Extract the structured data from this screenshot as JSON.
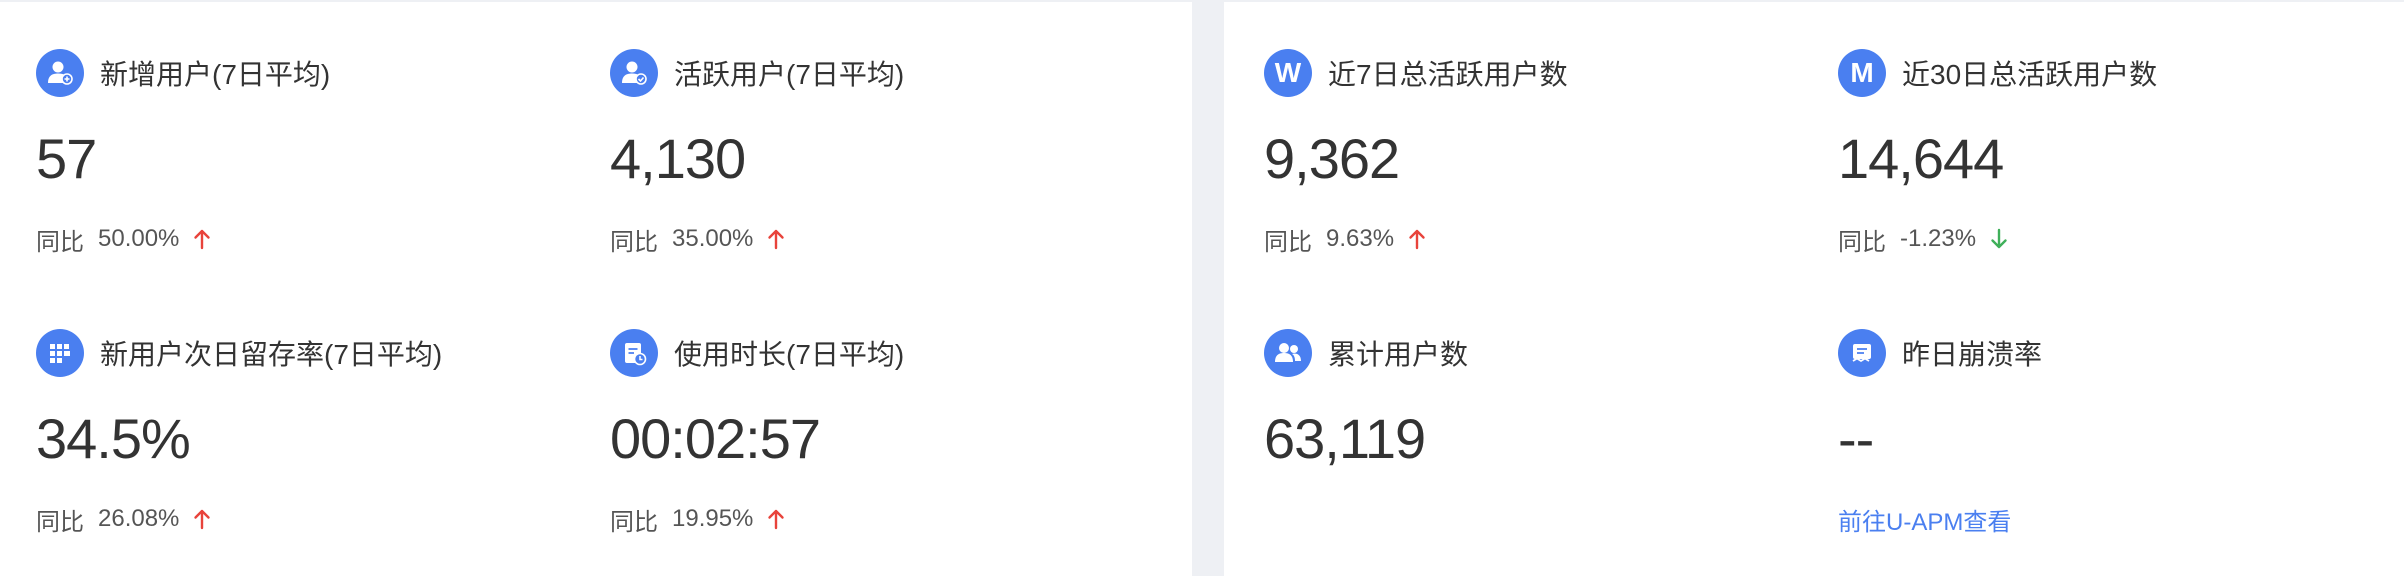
{
  "compare_label": "同比",
  "left_panel": {
    "cards": [
      {
        "title": "新增用户(7日平均)",
        "value": "57",
        "change": "50.00%",
        "trend": "up",
        "icon": "user-add-icon"
      },
      {
        "title": "活跃用户(7日平均)",
        "value": "4,130",
        "change": "35.00%",
        "trend": "up",
        "icon": "user-active-icon"
      },
      {
        "title": "新用户次日留存率(7日平均)",
        "value": "34.5%",
        "change": "26.08%",
        "trend": "up",
        "icon": "retention-grid-icon"
      },
      {
        "title": "使用时长(7日平均)",
        "value": "00:02:57",
        "change": "19.95%",
        "trend": "up",
        "icon": "duration-document-icon"
      }
    ]
  },
  "right_panel": {
    "cards": [
      {
        "title": "近7日总活跃用户数",
        "value": "9,362",
        "change": "9.63%",
        "trend": "up",
        "icon_letter": "W"
      },
      {
        "title": "近30日总活跃用户数",
        "value": "14,644",
        "change": "-1.23%",
        "trend": "down",
        "icon_letter": "M"
      },
      {
        "title": "累计用户数",
        "value": "63,119",
        "icon": "users-group-icon"
      },
      {
        "title": "昨日崩溃率",
        "value": "--",
        "link": "前往U-APM查看",
        "icon": "crash-report-icon"
      }
    ]
  },
  "colors": {
    "accent": "#4a7ff0",
    "trend_up": "#e8433b",
    "trend_down": "#3fb05a",
    "text_primary": "#333333",
    "background": "#eef0f4"
  }
}
